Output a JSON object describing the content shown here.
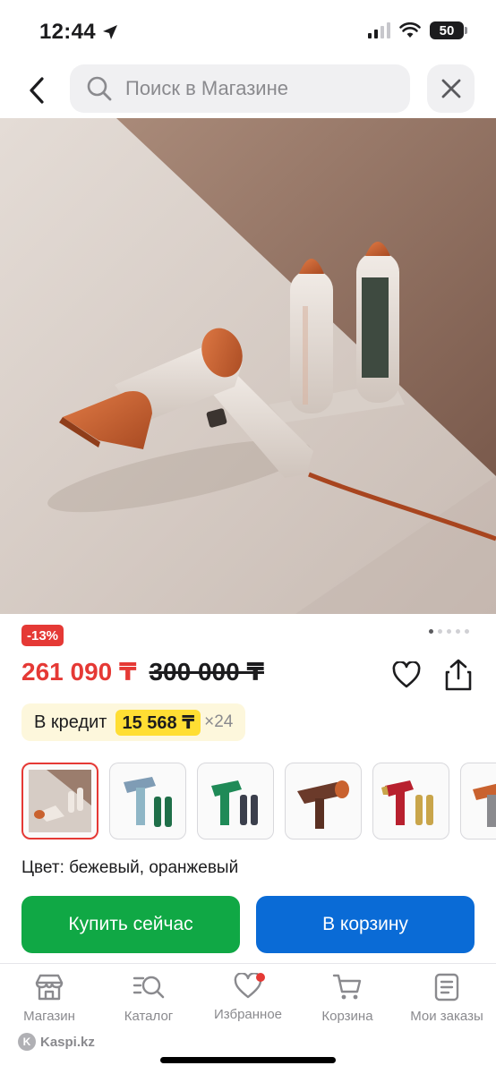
{
  "status_bar": {
    "time": "12:44",
    "battery": "50"
  },
  "search": {
    "placeholder": "Поиск в Магазине"
  },
  "product": {
    "discount_badge": "-13%",
    "price_current": "261 090 ₸",
    "price_old": "300 000 ₸",
    "credit": {
      "label": "В кредит",
      "amount": "15 568 ₸",
      "months": "×24"
    },
    "color_line": "Цвет: бежевый, оранжевый",
    "gallery_total_dots": 5,
    "gallery_active_dot": 1,
    "variants": [
      {
        "name": "beige-orange",
        "accent": "#c9622f"
      },
      {
        "name": "blue-grey",
        "accent": "#7f9cb5"
      },
      {
        "name": "green",
        "accent": "#1f8a57"
      },
      {
        "name": "brown",
        "accent": "#6b3a2a"
      },
      {
        "name": "red-gold",
        "accent": "#b8202e"
      },
      {
        "name": "orange",
        "accent": "#c9622f"
      }
    ]
  },
  "actions": {
    "buy_now": "Купить сейчас",
    "add_to_cart": "В корзину"
  },
  "tabs": [
    {
      "label": "Магазин",
      "icon": "shop-icon"
    },
    {
      "label": "Каталог",
      "icon": "catalog-search-icon"
    },
    {
      "label": "Избранное",
      "icon": "heart-icon"
    },
    {
      "label": "Корзина",
      "icon": "cart-icon"
    },
    {
      "label": "Мои заказы",
      "icon": "orders-icon"
    }
  ],
  "footer": {
    "logo_text": "Kaspi.kz"
  },
  "colors": {
    "discount_red": "#e53935",
    "buy_green": "#10a845",
    "cart_blue": "#0a6bd6",
    "credit_yellow": "#ffde33"
  }
}
